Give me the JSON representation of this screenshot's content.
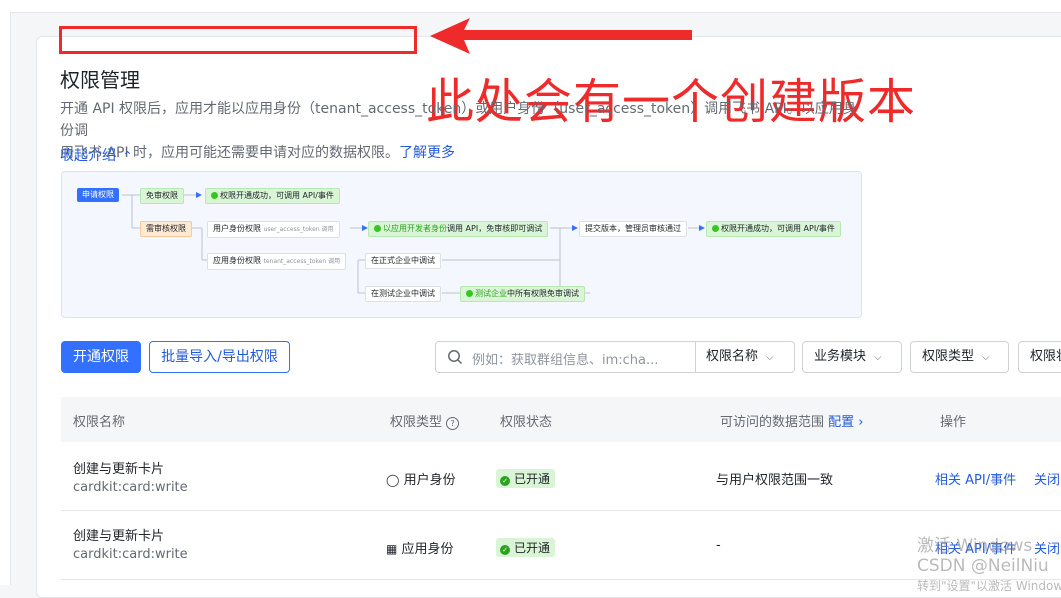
{
  "annotation": {
    "text": "此处会有一个创建版本",
    "color": "#ee2a2a"
  },
  "page": {
    "title": "权限管理",
    "description_line1": "开通 API 权限后，应用才能以应用身份（tenant_access_token）或用户身份（user_access_token）调用飞书 API。以应用身份调",
    "description_line2": "用飞书 API 时，应用可能还需要申请对应的数据权限。",
    "learn_more": "了解更多",
    "collapse_label": "收起介绍"
  },
  "flow": {
    "apply": "申请权限",
    "free": "免审权限",
    "free_result": "权限开通成功，可调用 API/事件",
    "review": "需审核权限",
    "user_perm": "用户身份权限",
    "user_token": "user_access_token 调用",
    "dev_debug_hl": "以应用开发者身份",
    "dev_debug_rest": "调用 API，免审核即可调试",
    "submit": "提交版本，管理员审核通过",
    "final_result": "权限开通成功，可调用 API/事件",
    "app_perm": "应用身份权限",
    "tenant_token": "tenant_access_token 调用",
    "formal": "在正式企业中调试",
    "test": "在测试企业中调试",
    "test_result_hl": "测试企业",
    "test_result_rest": "中所有权限免审调试"
  },
  "toolbar": {
    "enable_button": "开通权限",
    "batch_button": "批量导入/导出权限",
    "search_placeholder": "例如：获取群组信息、im:cha...",
    "search_field": "权限名称",
    "filter_module": "业务模块",
    "filter_type": "权限类型",
    "filter_status": "权限状"
  },
  "table": {
    "headers": {
      "name": "权限名称",
      "type": "权限类型",
      "status": "权限状态",
      "scope": "可访问的数据范围",
      "config": "配置",
      "action": "操作"
    },
    "rows": [
      {
        "name": "创建与更新卡片",
        "code": "cardkit:card:write",
        "type": "用户身份",
        "status": "已开通",
        "scope": "与用户权限范围一致",
        "api": "相关 API/事件",
        "close": "关闭"
      },
      {
        "name": "创建与更新卡片",
        "code": "cardkit:card:write",
        "type": "应用身份",
        "status": "已开通",
        "scope": "-",
        "api": "相关 API/事件",
        "close": "关闭"
      }
    ]
  },
  "watermark": {
    "line1": "激活 Windows",
    "line2": "CSDN @NeilNiu",
    "line3": "转到\"设置\"以激活 Windows"
  }
}
